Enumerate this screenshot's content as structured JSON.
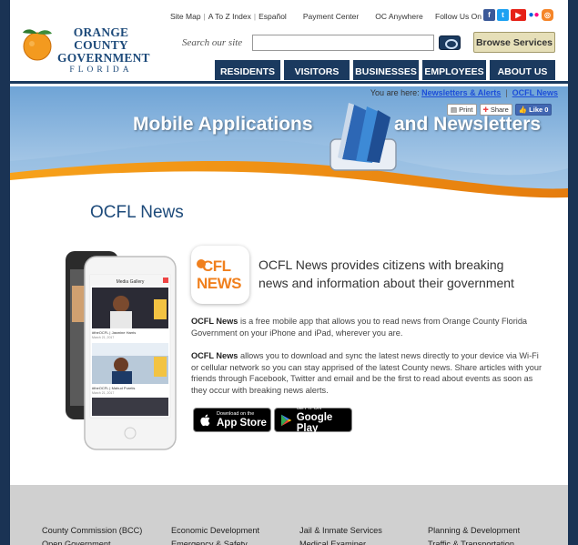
{
  "header": {
    "logo": {
      "line1": "ORANGE COUNTY",
      "line2": "GOVERNMENT",
      "line3": "FLORIDA"
    },
    "top_links": [
      "Site Map",
      "A To Z Index",
      "Español",
      "Payment Center",
      "OC Anywhere"
    ],
    "follow_label": "Follow Us On",
    "social_icons": [
      "facebook-icon",
      "twitter-icon",
      "youtube-icon",
      "flickr-icon",
      "instagram-icon"
    ],
    "search": {
      "label": "Search our site",
      "value": "",
      "placeholder": ""
    },
    "browse_button": "Browse Services",
    "nav": [
      "RESIDENTS",
      "VISITORS",
      "BUSINESSES",
      "EMPLOYEES",
      "ABOUT US"
    ]
  },
  "banner": {
    "breadcrumb_prefix": "You are here:",
    "breadcrumb": [
      "Newsletters & Alerts",
      "OCFL News"
    ],
    "tools": {
      "print": "Print",
      "share": "Share",
      "like": "Like 0"
    },
    "title_left": "Mobile Applications",
    "title_right": "and Newsletters"
  },
  "main": {
    "heading": "OCFL News",
    "app_icon": {
      "line1": "CFL",
      "line2": "NEWS"
    },
    "tagline": "OCFL News provides citizens with breaking news and information about their government",
    "p1_bold": "OCFL News",
    "p1_text": " is a free mobile app that allows you to read news from Orange County Florida Government on your iPhone and iPad, wherever you are.",
    "p2_bold": "OCFL News",
    "p2_text": " allows you to download and sync the latest news directly to your device via Wi-Fi or cellular network so you can stay apprised of the latest County news. Share articles with your friends through Facebook, Twitter and email and be the first to read about events as soon as they occur with breaking news alerts.",
    "phone": {
      "screen_title": "Media Gallery",
      "caption1": "#theOCFL | Jasmine Harris",
      "date1": "March 21, 2017",
      "caption2": "#theOCFL | Mahud Puretis",
      "date2": "March 21, 2017"
    },
    "app_store": {
      "small": "Download on the",
      "big": "App Store"
    },
    "google_play": {
      "small": "GET IT ON",
      "big": "Google Play"
    }
  },
  "footer": {
    "col1": [
      "County Commission (BCC)",
      "Open Government"
    ],
    "col2": [
      "Economic Development",
      "Emergency & Safety"
    ],
    "col3": [
      "Jail & Inmate Services",
      "Medical Examiner"
    ],
    "col4": [
      "Planning & Development",
      "Traffic & Transportation"
    ]
  }
}
